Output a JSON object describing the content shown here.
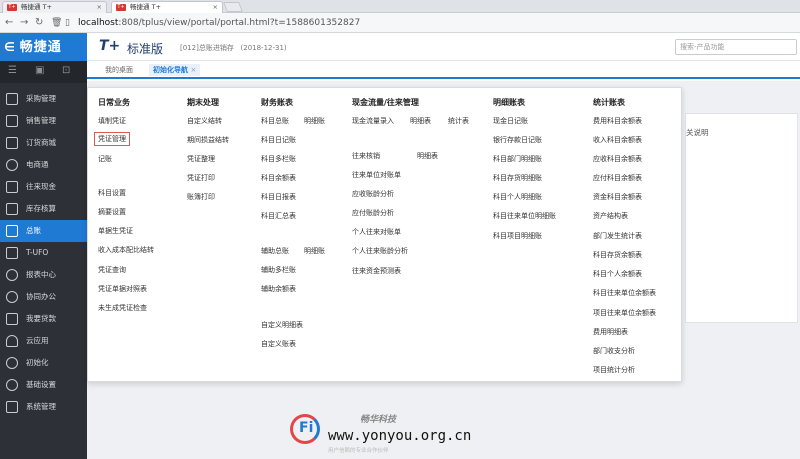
{
  "browser": {
    "tabs": [
      {
        "favicon": "T+",
        "title": "畅捷通 T+",
        "active": false
      },
      {
        "favicon": "T+",
        "title": "畅捷通 T+",
        "active": true
      }
    ],
    "url_host": "localhost",
    "url_path": ":808/tplus/view/portal/portal.html?t=1588601352827"
  },
  "sidebar": {
    "logo": "畅捷通",
    "items": [
      {
        "label": "采购管理",
        "icon": "cart-icon"
      },
      {
        "label": "销售管理",
        "icon": "sales-icon"
      },
      {
        "label": "订货商城",
        "icon": "store-icon"
      },
      {
        "label": "电商通",
        "icon": "ecommerce-icon"
      },
      {
        "label": "往来现金",
        "icon": "exchange-icon"
      },
      {
        "label": "库存核算",
        "icon": "warehouse-icon"
      },
      {
        "label": "总账",
        "icon": "ledger-icon",
        "active": true
      },
      {
        "label": "T-UFO",
        "icon": "ufo-icon"
      },
      {
        "label": "报表中心",
        "icon": "report-icon"
      },
      {
        "label": "协同办公",
        "icon": "collab-icon"
      },
      {
        "label": "我要贷款",
        "icon": "loan-icon"
      },
      {
        "label": "云应用",
        "icon": "cloud-icon"
      },
      {
        "label": "初始化",
        "icon": "init-icon"
      },
      {
        "label": "基础设置",
        "icon": "settings-icon"
      },
      {
        "label": "系统管理",
        "icon": "system-icon"
      }
    ]
  },
  "header": {
    "product_logo": "T+",
    "product_name": "标准版",
    "account": "[012]总账进销存",
    "date": "(2018-12-31)",
    "search_placeholder": "搜索-产品功能"
  },
  "tabs": [
    {
      "label": "我的桌面",
      "active": false
    },
    {
      "label": "初始化导航",
      "active": true,
      "close": "×"
    }
  ],
  "right_panel_text": "关说明",
  "menu": {
    "columns": [
      {
        "header": "日常业务",
        "items": [
          "填制凭证",
          "凭证管理",
          "记账",
          "",
          "",
          "科目设置",
          "摘要设置",
          "单据生凭证",
          "收入成本配比结转",
          "凭证查询",
          "凭证单据对照表",
          "未生成凭证检查"
        ]
      },
      {
        "header": "期末处理",
        "items": [
          "自定义结转",
          "期间损益结转",
          "凭证整理",
          "凭证打印",
          "账簿打印"
        ]
      },
      {
        "header": "财务账表",
        "items": [
          "科目总账",
          "明细账",
          "科目日记账",
          "科目多栏账",
          "科目余额表",
          "科目日报表",
          "科目汇总表",
          "辅助总账",
          "明细账",
          "辅助多栏账",
          "辅助余额表",
          "自定义明细表",
          "自定义账表"
        ]
      },
      {
        "header": "现金流量/往来管理",
        "items": [
          "现金流量录入",
          "明细表",
          "统计表",
          "往来核销",
          "明细表",
          "往来单位对账单",
          "应收账龄分析",
          "应付账龄分析",
          "个人往来对账单",
          "个人往来账龄分析",
          "往来资金预测表"
        ]
      },
      {
        "header": "明细账表",
        "items": [
          "现金日记账",
          "银行存款日记账",
          "科目部门明细账",
          "科目存货明细账",
          "科目个人明细账",
          "科目往来单位明细账",
          "科目项目明细账"
        ]
      },
      {
        "header": "统计账表",
        "items": [
          "费用科目余额表",
          "收入科目余额表",
          "应收科目余额表",
          "应付科目余额表",
          "资金科目余额表",
          "资产结构表",
          "部门发生统计表",
          "科目存货余额表",
          "科目个人余额表",
          "科目往来单位余额表",
          "项目往来单位余额表",
          "费用明细表",
          "部门收支分析",
          "项目统计分析"
        ]
      }
    ]
  },
  "watermark": {
    "company": "畅华科技",
    "url": "www.yonyou.org.cn",
    "slogan": "用户信赖的专业合作伙伴"
  }
}
